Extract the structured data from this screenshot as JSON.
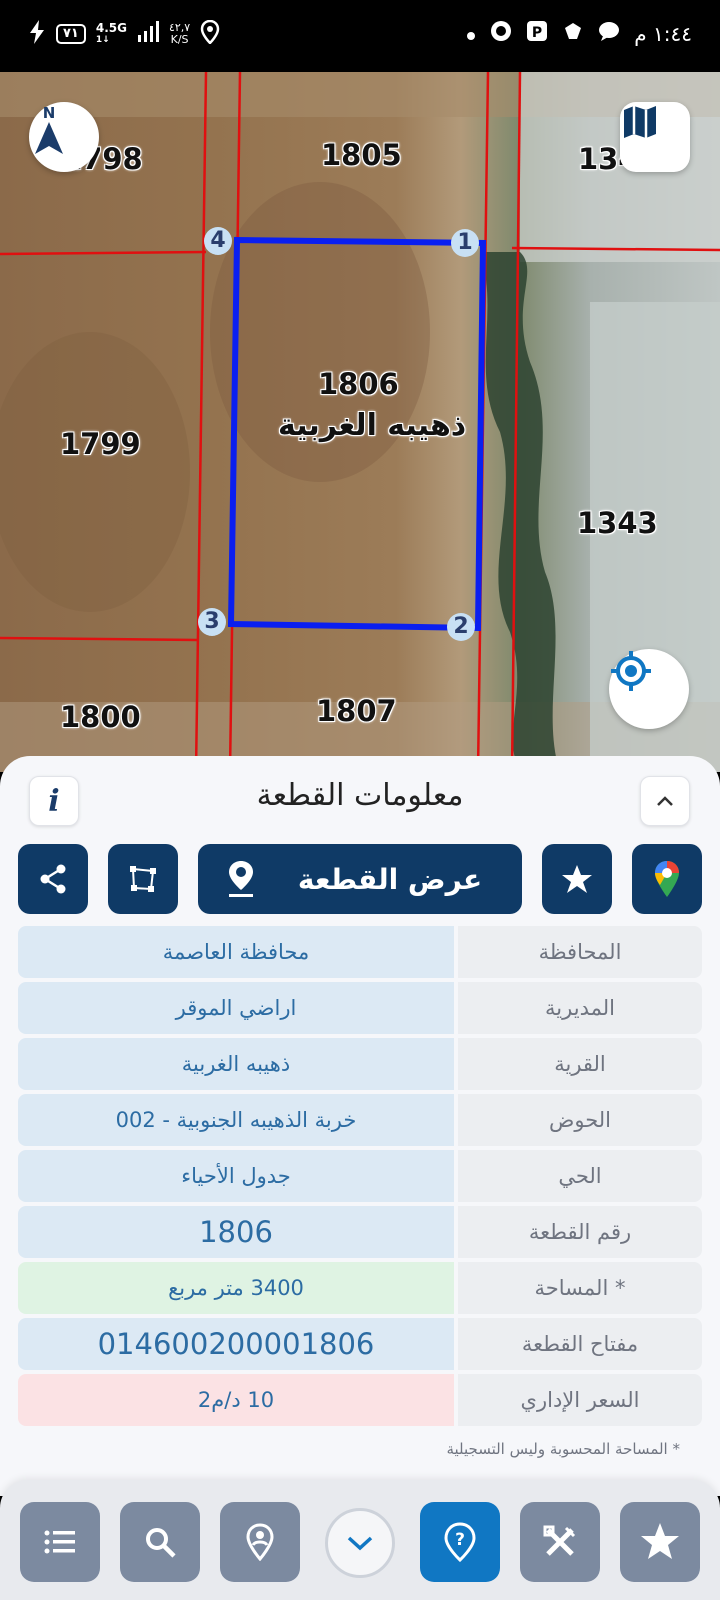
{
  "status_bar": {
    "time": "١:٤٤ م",
    "battery": "٧١",
    "network": "4.5G",
    "network_sub": "1↓",
    "speed_value": "٤٢,٧",
    "speed_unit": "K/S"
  },
  "map": {
    "plots": {
      "p1798": "1798",
      "p1805": "1805",
      "p1342": "1342",
      "p1806": "1806",
      "p1806_name": "ذهيبه الغربية",
      "p1799": "1799",
      "p1343": "1343",
      "p1800": "1800",
      "p1807": "1807"
    },
    "corners": [
      "1",
      "2",
      "3",
      "4"
    ],
    "compass_letter": "N",
    "boundary_color": "#0a1ff0",
    "grid_line_color": "#e01010"
  },
  "sheet": {
    "title": "معلومات القطعة",
    "show_plot_label": "عرض القطعة",
    "rows": [
      {
        "key": "المحافظة",
        "value": "محافظة العاصمة"
      },
      {
        "key": "المديرية",
        "value": "اراضي الموقر"
      },
      {
        "key": "القرية",
        "value": "ذهيبه الغربية"
      },
      {
        "key": "الحوض",
        "value": "خربة الذهيبه الجنوبية - 002"
      },
      {
        "key": "الحي",
        "value": "جدول الأحياء"
      },
      {
        "key": "رقم القطعة",
        "value": "1806"
      },
      {
        "key": "المساحة *",
        "value": "3400  متر مربع"
      },
      {
        "key": "مفتاح القطعة",
        "value": "014600200001806"
      },
      {
        "key": "السعر الإداري",
        "value": "10 د/م2"
      }
    ],
    "footnote": "* المساحة المحسوبة وليس التسجيلية"
  },
  "colors": {
    "navy": "#0f3a66",
    "accent": "#1077c3",
    "value_text": "#2c6ca3"
  }
}
